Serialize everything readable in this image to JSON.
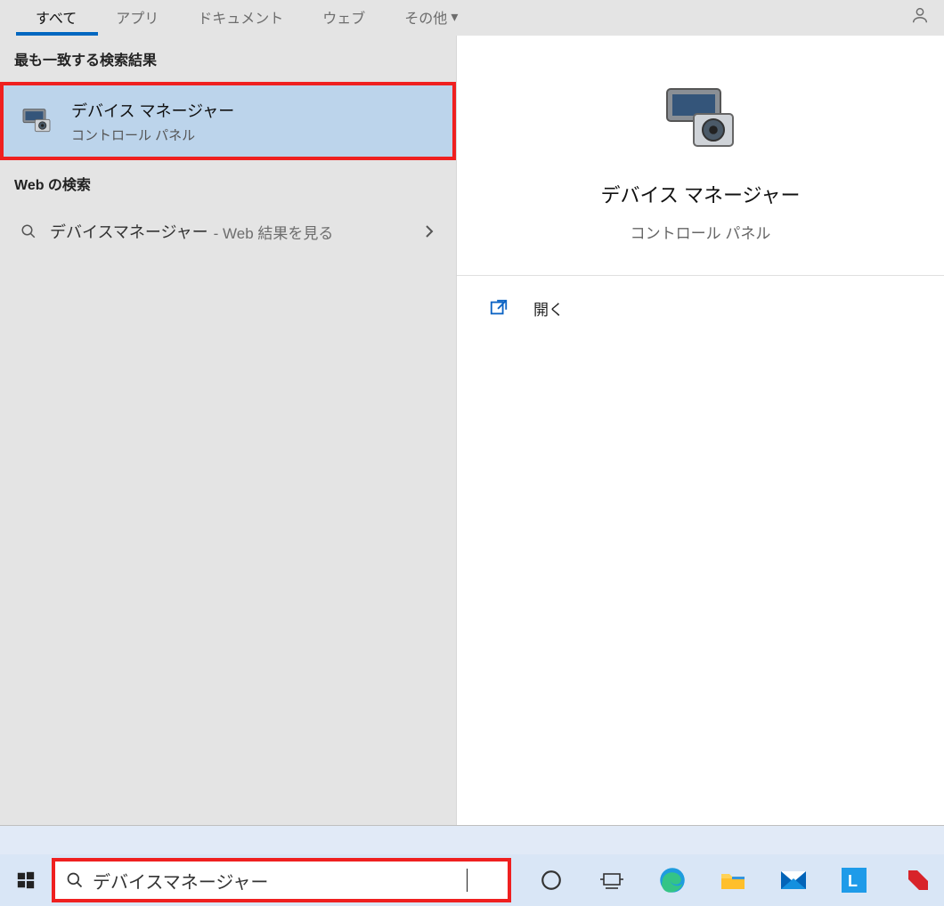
{
  "tabs": {
    "all": "すべて",
    "apps": "アプリ",
    "docs": "ドキュメント",
    "web": "ウェブ",
    "more": "その他"
  },
  "sections": {
    "best_match": "最も一致する検索結果",
    "web_search": "Web の検索"
  },
  "best_match": {
    "title": "デバイス マネージャー",
    "subtitle": "コントロール パネル"
  },
  "web_row": {
    "query": "デバイスマネージャー",
    "suffix": " - Web 結果を見る"
  },
  "preview": {
    "title": "デバイス マネージャー",
    "subtitle": "コントロール パネル",
    "open_label": "開く"
  },
  "search_input": {
    "value": "デバイスマネージャー"
  }
}
